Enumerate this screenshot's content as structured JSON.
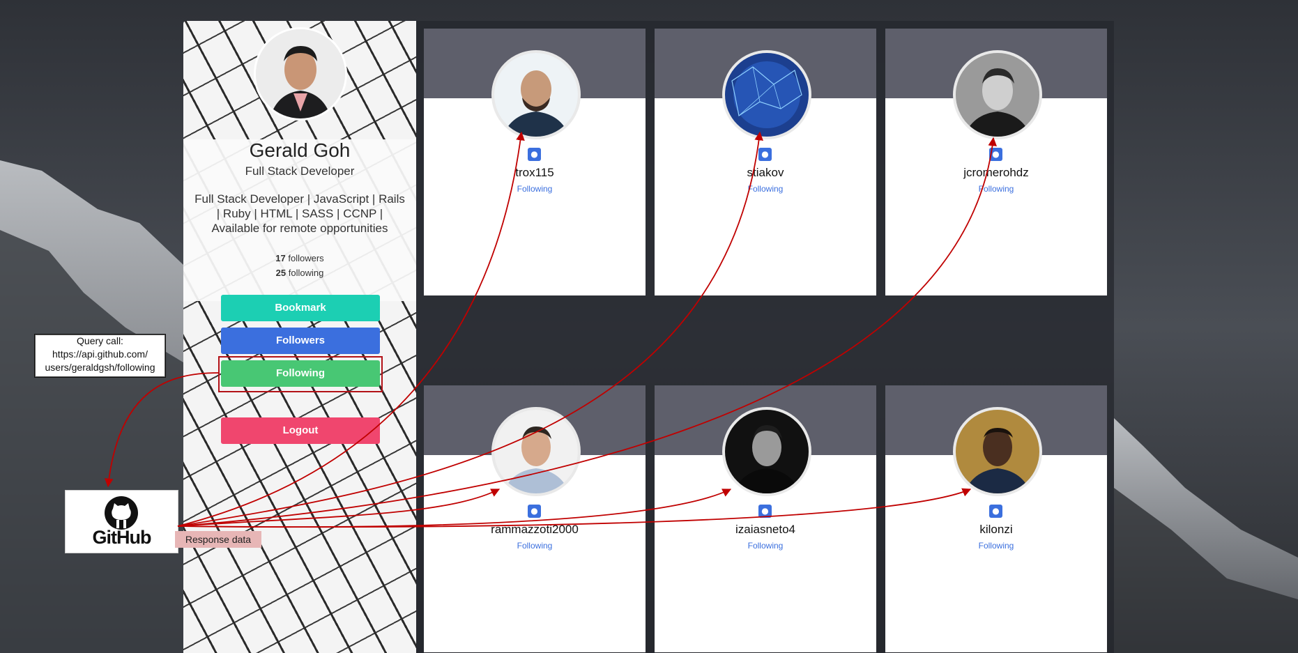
{
  "profile": {
    "name": "Gerald Goh",
    "role": "Full Stack Developer",
    "bio": "Full Stack Developer | JavaScript | Rails | Ruby | HTML | SASS | CCNP | Available for remote opportunities",
    "followers_count": "17",
    "followers_word": "followers",
    "following_count": "25",
    "following_word": "following"
  },
  "buttons": {
    "bookmark": "Bookmark",
    "followers": "Followers",
    "following": "Following",
    "logout": "Logout"
  },
  "cards": [
    {
      "username": "trox115",
      "status": "Following"
    },
    {
      "username": "stiakov",
      "status": "Following"
    },
    {
      "username": "jcromerohdz",
      "status": "Following"
    },
    {
      "username": "rammazzoti2000",
      "status": "Following"
    },
    {
      "username": "izaiasneto4",
      "status": "Following"
    },
    {
      "username": "kilonzi",
      "status": "Following"
    }
  ],
  "annotation": {
    "query_line1": "Query call:",
    "query_line2": "https://api.github.com/",
    "query_line3": "users/geraldgsh/following",
    "github_label": "GitHub",
    "response_label": "Response data"
  },
  "colors": {
    "bookmark": "#1ccfb3",
    "followers": "#3b6fde",
    "following": "#48c774",
    "logout": "#f0466e",
    "arrow": "#c00000",
    "card_band": "#5e5f6b"
  },
  "icons": {
    "card_badge": "github-icon",
    "logo": "github-octocat-icon"
  }
}
